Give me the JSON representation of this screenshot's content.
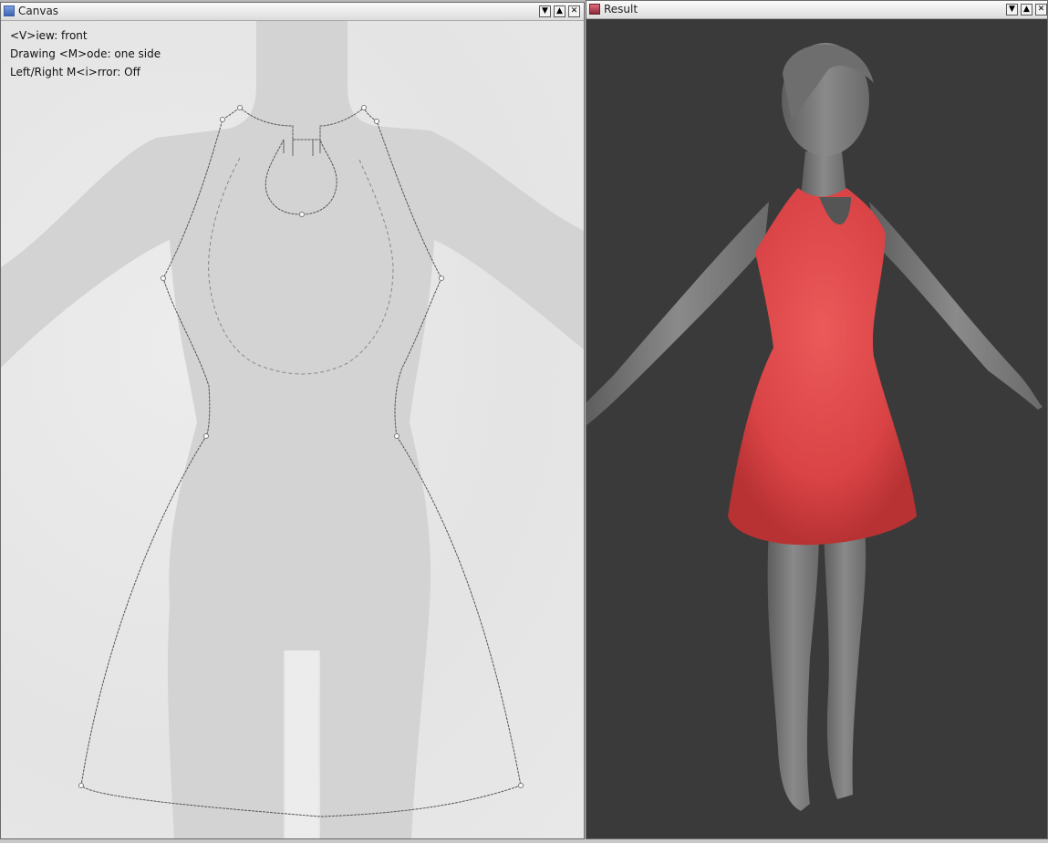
{
  "canvas_window": {
    "title": "Canvas",
    "icon": "canvas-app-icon",
    "controls": [
      "minimize",
      "maximize",
      "close"
    ],
    "overlay_lines": [
      "<V>iew: front",
      "Drawing <M>ode: one side",
      "Left/Right M<i>rror: Off"
    ]
  },
  "result_window": {
    "title": "Result",
    "icon": "result-app-icon",
    "controls": [
      "minimize",
      "maximize",
      "close"
    ]
  },
  "colors": {
    "dress": "#e0484a",
    "mannequin": "#7d7d7d",
    "result_bg": "#3a3a3a",
    "canvas_bg": "#e6e6e6",
    "silhouette": "#d2d2d2"
  }
}
